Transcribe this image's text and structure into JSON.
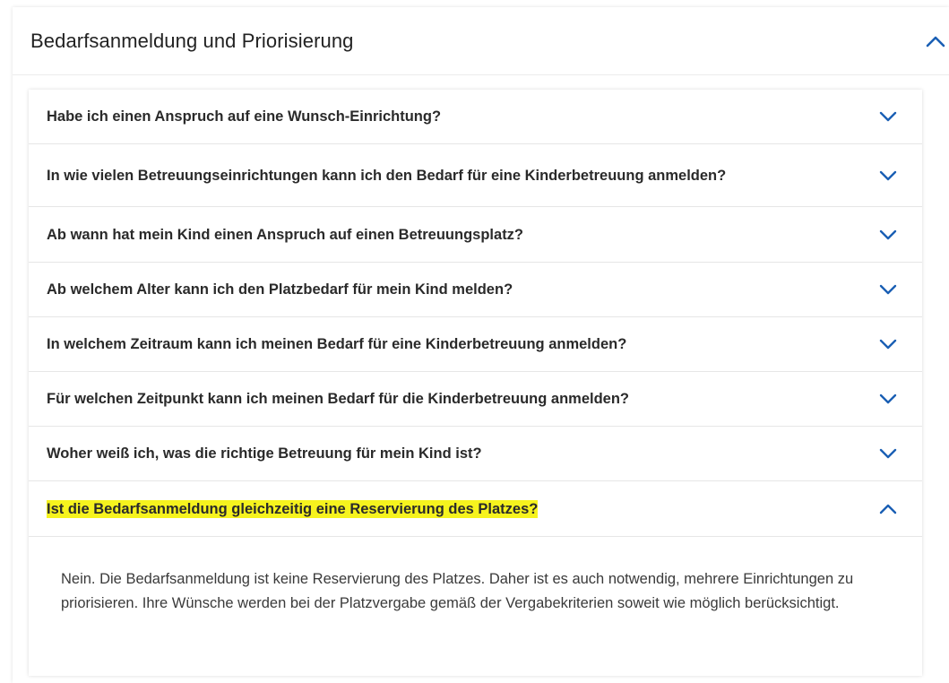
{
  "section": {
    "title": "Bedarfsanmeldung und Priorisierung",
    "expanded": true,
    "chevron_icon": "chevron-up-icon"
  },
  "colors": {
    "chevron": "#1a5fb4",
    "highlight": "#f6f31e"
  },
  "faq": {
    "items": [
      {
        "question": "Habe ich einen Anspruch auf eine Wunsch-Einrichtung?",
        "expanded": false,
        "icon": "chevron-down-icon"
      },
      {
        "question": "In wie vielen Betreuungseinrichtungen kann ich den Bedarf für eine Kinderbetreuung anmelden?",
        "expanded": false,
        "icon": "chevron-down-icon"
      },
      {
        "question": "Ab wann hat mein Kind einen Anspruch auf einen Betreuungsplatz?",
        "expanded": false,
        "icon": "chevron-down-icon"
      },
      {
        "question": "Ab welchem Alter kann ich den Platzbedarf für mein Kind melden?",
        "expanded": false,
        "icon": "chevron-down-icon"
      },
      {
        "question": "In welchem Zeitraum kann ich meinen Bedarf für eine Kinderbetreuung anmelden?",
        "expanded": false,
        "icon": "chevron-down-icon"
      },
      {
        "question": "Für welchen Zeitpunkt kann ich meinen Bedarf für die Kinderbetreuung anmelden?",
        "expanded": false,
        "icon": "chevron-down-icon"
      },
      {
        "question": "Woher weiß ich, was die richtige Betreuung für mein Kind ist?",
        "expanded": false,
        "icon": "chevron-down-icon"
      },
      {
        "question": "Ist die Bedarfsanmeldung gleichzeitig eine Reservierung des Platzes?",
        "expanded": true,
        "icon": "chevron-up-icon",
        "highlighted": true
      }
    ],
    "answer": "Nein. Die Bedarfsanmeldung ist keine Reservierung des Platzes. Daher ist es auch notwendig, mehrere Einrichtungen zu priorisieren. Ihre Wünsche werden bei der Platzvergabe gemäß der Vergabekriterien soweit wie möglich berücksichtigt."
  }
}
